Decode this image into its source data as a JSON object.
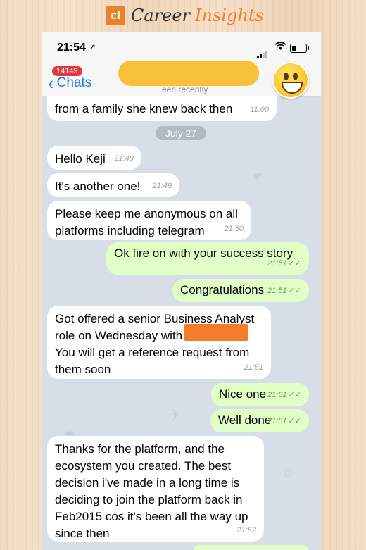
{
  "brand": {
    "logo": "ci",
    "name": "Career",
    "name_accent": "Insights"
  },
  "status_bar": {
    "time": "21:54",
    "location_glyph": "➚"
  },
  "header": {
    "back_label": "Chats",
    "unread_badge": "14149",
    "last_seen": "een recently"
  },
  "date_separator": "July 27",
  "messages": [
    {
      "direction": "in",
      "text": "from a family she knew back then",
      "time": "11:00"
    },
    {
      "direction": "in",
      "text": "Hello Keji",
      "time": "21:49"
    },
    {
      "direction": "in",
      "text": "It's another one!",
      "time": "21:49"
    },
    {
      "direction": "in",
      "lines": [
        "Please keep me anonymous on all",
        "platforms including telegram"
      ],
      "time": "21:50"
    },
    {
      "direction": "out",
      "text": "Ok fire on with your success story",
      "time": "21:51"
    },
    {
      "direction": "out",
      "text": "Congratulations",
      "time": "21:51"
    },
    {
      "direction": "in",
      "lines": [
        "Got offered a senior Business Analyst",
        "role on Wednesday with",
        "You will get a reference request from",
        "them soon"
      ],
      "time": "21:51"
    },
    {
      "direction": "out",
      "text": "Nice one",
      "time": "21:51"
    },
    {
      "direction": "out",
      "text": "Well done",
      "time": "21:51"
    },
    {
      "direction": "in",
      "lines": [
        "Thanks for the platform, and the",
        "ecosystem you created. The best",
        "decision i've made in a long time is",
        "deciding to join the platform back in",
        "Feb2015 cos it's been all the way up",
        "since then"
      ],
      "time": "21:52"
    }
  ],
  "colors": {
    "incoming_bubble": "#ffffff",
    "outgoing_bubble": "#e1fec6",
    "link_blue": "#1a7ae0",
    "badge_red": "#e0393e",
    "brand_orange": "#f07f2a"
  }
}
